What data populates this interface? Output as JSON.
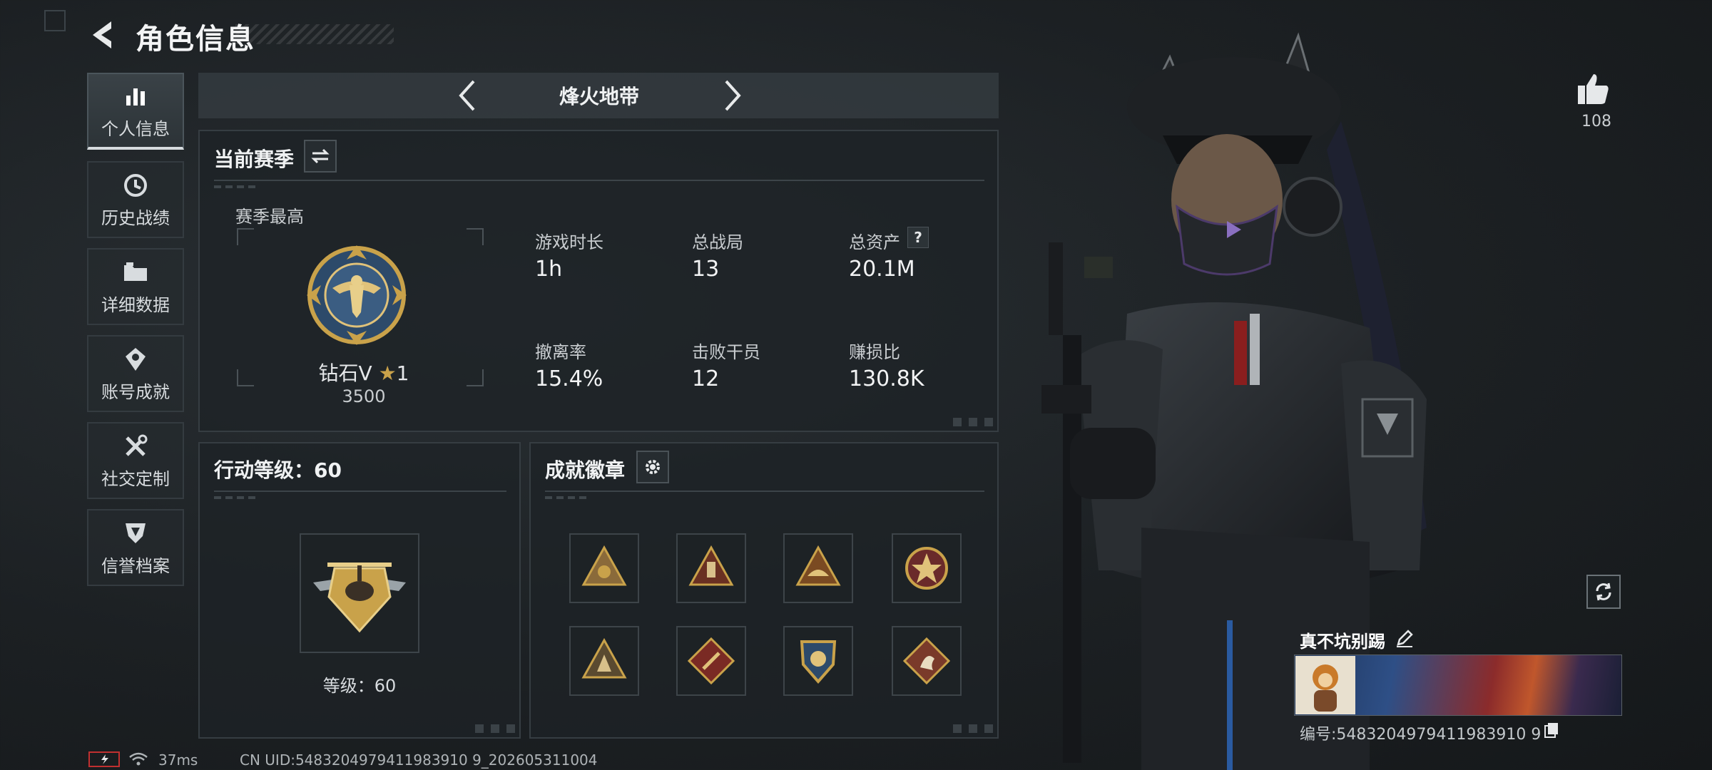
{
  "header": {
    "title": "角色信息"
  },
  "sidebar": {
    "items": [
      {
        "label": "个人信息",
        "icon": "bar-chart-icon",
        "active": true
      },
      {
        "label": "历史战绩",
        "icon": "history-clock-icon"
      },
      {
        "label": "详细数据",
        "icon": "folder-icon"
      },
      {
        "label": "账号成就",
        "icon": "achievement-icon"
      },
      {
        "label": "社交定制",
        "icon": "tools-icon"
      },
      {
        "label": "信誉档案",
        "icon": "shield-badge-icon"
      }
    ]
  },
  "mode_selector": {
    "label": "烽火地带"
  },
  "season_panel": {
    "title": "当前赛季",
    "best_label": "赛季最高",
    "rank_name": "钻石V",
    "rank_stars": "1",
    "rank_points": "3500",
    "stats": [
      {
        "label": "游戏时长",
        "value": "1h"
      },
      {
        "label": "总战局",
        "value": "13"
      },
      {
        "label": "总资产",
        "value": "20.1M",
        "help": "?"
      },
      {
        "label": "撤离率",
        "value": "15.4%"
      },
      {
        "label": "击败干员",
        "value": "12"
      },
      {
        "label": "赚损比",
        "value": "130.8K"
      }
    ]
  },
  "action_panel": {
    "title": "行动等级：60",
    "level_label": "等级：60"
  },
  "badges_panel": {
    "title": "成就徽章",
    "badges": [
      "triangle-emblem-icon",
      "triangle-emblem-icon",
      "triangle-emblem-icon",
      "round-emblem-icon",
      "triangle-emblem-icon",
      "diamond-emblem-icon",
      "shield-emblem-icon",
      "diamond-emblem-icon"
    ]
  },
  "profile": {
    "like_count": "108",
    "player_name": "真不坑别踢",
    "player_id": "编号:5483204979411983910 9"
  },
  "status": {
    "ping": "37ms",
    "uid": "CN UID:5483204979411983910 9_202605311004"
  },
  "colors": {
    "accent_gold": "#c9a24a",
    "panel_border": "#363d42",
    "background": "#1c2023"
  }
}
